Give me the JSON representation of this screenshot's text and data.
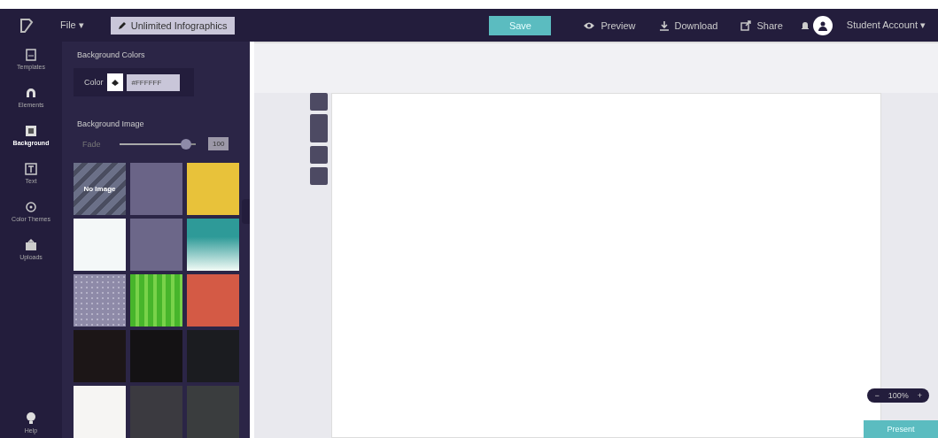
{
  "topbar": {
    "file_menu": "File ▾",
    "upgrade": "Unlimited Infographics",
    "save": "Save",
    "actions": [
      {
        "kind": "preview",
        "label": "Preview"
      },
      {
        "kind": "download",
        "label": "Download"
      },
      {
        "kind": "share",
        "label": "Share"
      }
    ],
    "user": "Student Account ▾"
  },
  "sidebar": {
    "items": [
      {
        "kind": "templates",
        "label": "Templates",
        "selected": false
      },
      {
        "kind": "elements",
        "label": "Elements",
        "selected": false
      },
      {
        "kind": "background",
        "label": "Background",
        "selected": true
      },
      {
        "kind": "text",
        "label": "Text",
        "selected": false
      },
      {
        "kind": "themes",
        "label": "Color Themes",
        "selected": false
      },
      {
        "kind": "uploads",
        "label": "Uploads",
        "selected": false
      }
    ],
    "help": "Help"
  },
  "panel": {
    "color_title": "Background Colors",
    "color_label": "Color",
    "color_value": "#FFFFFF",
    "image_title": "Background Image",
    "fade_label": "Fade",
    "slider": {
      "level": 0.93
    },
    "fade_value": "100",
    "tiles": [
      {
        "kind": "none",
        "label": "No Image",
        "color": "#6b7088"
      },
      {
        "kind": "solid",
        "color": "#6a6487"
      },
      {
        "kind": "solid",
        "color": "#e8c23a"
      },
      {
        "kind": "solid",
        "color": "#f4f8f8"
      },
      {
        "kind": "solid",
        "color": "#6c6789"
      },
      {
        "kind": "gradient",
        "color": "#2e9a98"
      },
      {
        "kind": "dots",
        "color": "#8e8aa8"
      },
      {
        "kind": "stripes",
        "color": "#47b52b"
      },
      {
        "kind": "solid",
        "color": "#d45a45"
      },
      {
        "kind": "solid",
        "color": "#1c1617"
      },
      {
        "kind": "solid",
        "color": "#141214"
      },
      {
        "kind": "solid",
        "color": "#1b1c20"
      },
      {
        "kind": "solid",
        "color": "#f6f5f3"
      },
      {
        "kind": "solid",
        "color": "#3b3a40"
      },
      {
        "kind": "solid",
        "color": "#3a3d3e"
      }
    ]
  },
  "zoom": {
    "minus": "−",
    "value": "100%",
    "plus": "+"
  },
  "present": "Present"
}
